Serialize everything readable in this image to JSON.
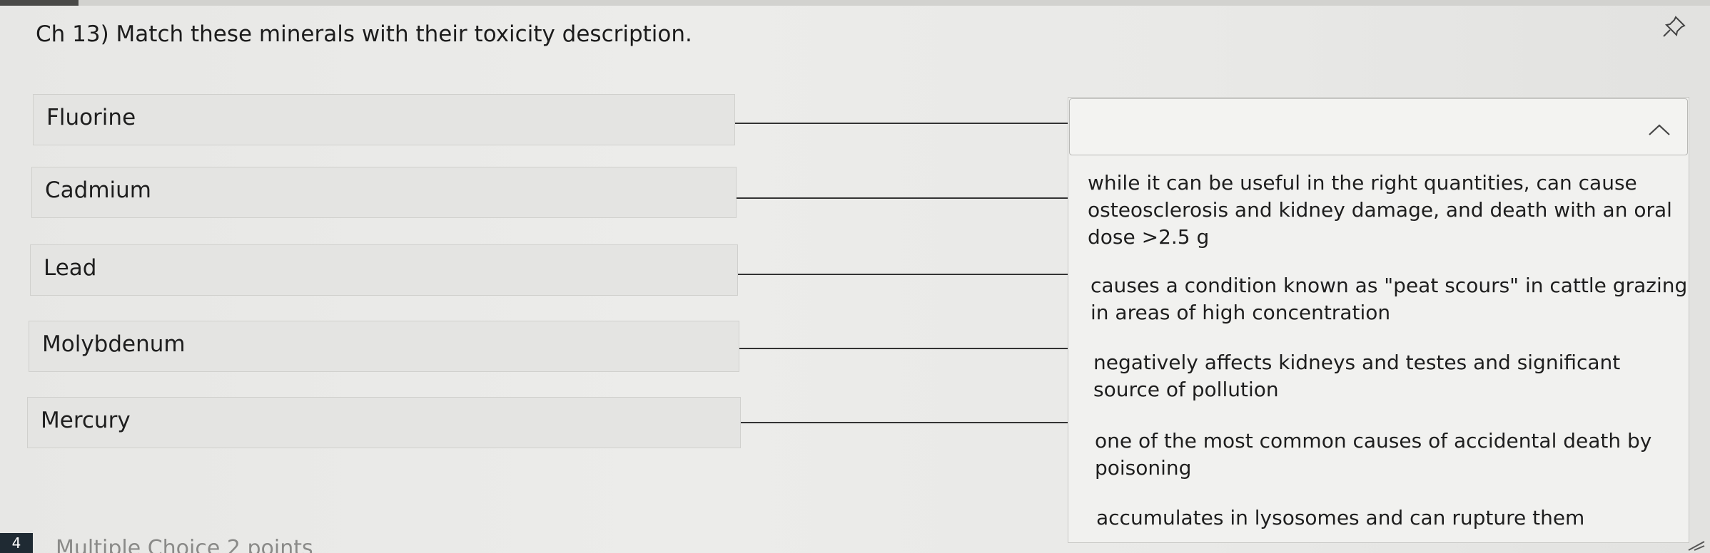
{
  "question": {
    "title": "Ch 13) Match these minerals with their toxicity description."
  },
  "terms": [
    {
      "label": "Fluorine"
    },
    {
      "label": "Cadmium"
    },
    {
      "label": "Lead"
    },
    {
      "label": "Molybdenum"
    },
    {
      "label": "Mercury"
    }
  ],
  "dropdown": {
    "selected": "",
    "options": [
      "while it can be useful in the right quantities, can cause osteosclerosis and kidney damage, and death with an oral dose >2.5 g",
      "causes a condition known as \"peat scours\" in cattle grazing in areas of high concentration",
      "negatively affects kidneys and testes and significant source of pollution",
      "one of the most common causes of accidental death by poisoning",
      "accumulates in lysosomes and can rupture them"
    ]
  },
  "footer": {
    "question_number": "4",
    "next_question_label": "Multiple Choice   2 points"
  },
  "icons": {
    "pin": "pin-icon",
    "chevron": "chevron-up-icon"
  },
  "colors": {
    "term_background": "#e4e4e2",
    "dropdown_background": "#f1f1ef",
    "connector_line": "#333333"
  }
}
